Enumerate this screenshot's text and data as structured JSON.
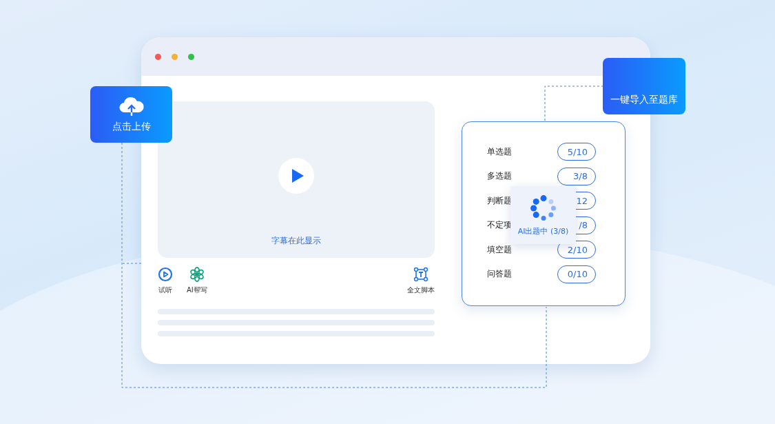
{
  "upload_badge": {
    "label": "点击上传"
  },
  "import_badge": {
    "label": "一键导入至题库"
  },
  "video": {
    "caption": "字幕在此显示"
  },
  "tools": [
    {
      "kind": "play",
      "label": "试听"
    },
    {
      "kind": "ai",
      "label": "AI帮写"
    },
    {
      "kind": "script",
      "label": "全文脚本"
    }
  ],
  "question_types": [
    {
      "label": "单选题",
      "count": "5/10"
    },
    {
      "label": "多选题",
      "count": "3/8"
    },
    {
      "label": "判断题",
      "count": "12"
    },
    {
      "label": "不定项",
      "count": "/8"
    },
    {
      "label": "填空题",
      "count": "2/10"
    },
    {
      "label": "问答题",
      "count": "0/10"
    }
  ],
  "progress_popup": {
    "label": "AI出题中 (3/8)"
  }
}
